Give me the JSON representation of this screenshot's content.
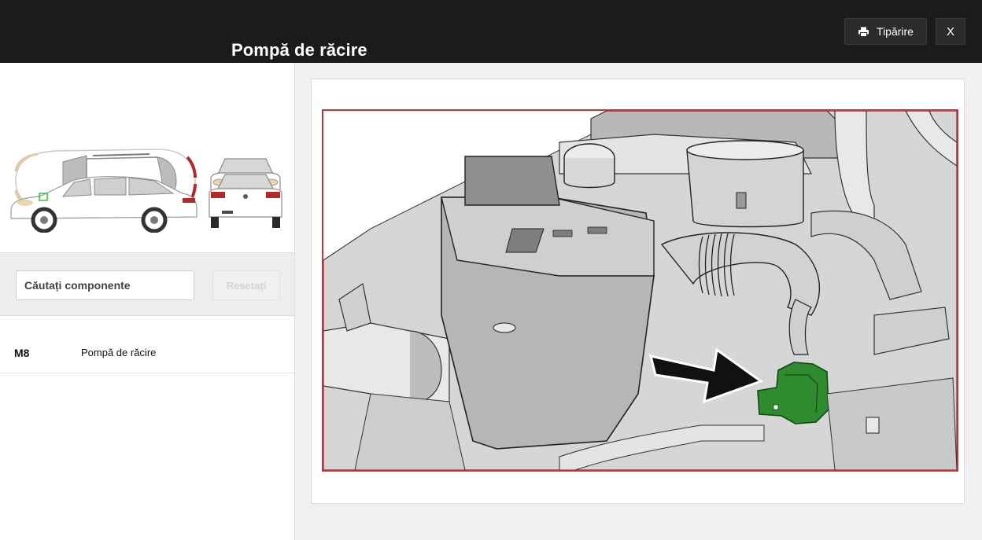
{
  "header": {
    "title": "Pompă de răcire",
    "print_label": "Tipărire",
    "close_label": "X"
  },
  "search": {
    "placeholder": "Căutați componente",
    "reset_label": "Resetați"
  },
  "components": [
    {
      "code": "M8",
      "name": "Pompă de răcire"
    }
  ],
  "colors": {
    "header_bg": "#1b1b1b",
    "frame_border": "#c8323c",
    "highlight_green": "#2e8b2e",
    "marker_green": "#34c434"
  },
  "icons": {
    "print": "printer-icon"
  }
}
